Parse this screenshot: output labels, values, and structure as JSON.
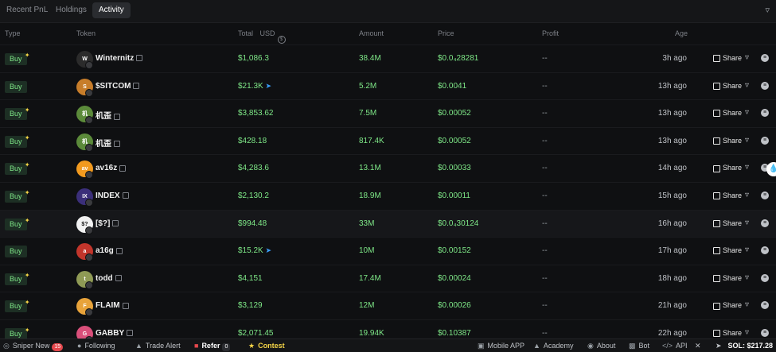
{
  "tabs": {
    "recent_pnl": "Recent PnL",
    "holdings": "Holdings",
    "activity": "Activity"
  },
  "columns": {
    "type": "Type",
    "token": "Token",
    "total": "Total",
    "total_unit": "USD",
    "amount": "Amount",
    "price": "Price",
    "profit": "Profit",
    "age": "Age"
  },
  "rows": [
    {
      "type": "Buy",
      "token": "Winternitz",
      "total": "$1,086.3",
      "amount": "38.4M",
      "price": "$0.0₄28281",
      "profit": "--",
      "age": "3h ago",
      "share": "Share",
      "avatar_color": "#2b2b2b",
      "avatar_text": "W"
    },
    {
      "type": "Buy",
      "token": "$SITCOM",
      "total": "$21.3K",
      "amount": "5.2M",
      "price": "$0.0041",
      "profit": "--",
      "age": "13h ago",
      "share": "Share",
      "avatar_color": "#c77d2a",
      "avatar_text": "S"
    },
    {
      "type": "Buy",
      "token": "机歪",
      "total": "$3,853.62",
      "amount": "7.5M",
      "price": "$0.00052",
      "profit": "--",
      "age": "13h ago",
      "share": "Share",
      "avatar_color": "#5b8a3a",
      "avatar_text": "机"
    },
    {
      "type": "Buy",
      "token": "机歪",
      "total": "$428.18",
      "amount": "817.4K",
      "price": "$0.00052",
      "profit": "--",
      "age": "13h ago",
      "share": "Share",
      "avatar_color": "#5b8a3a",
      "avatar_text": "机"
    },
    {
      "type": "Buy",
      "token": "av16z",
      "total": "$4,283.6",
      "amount": "13.1M",
      "price": "$0.00033",
      "profit": "--",
      "age": "14h ago",
      "share": "Share",
      "avatar_color": "#f29a1f",
      "avatar_text": "av"
    },
    {
      "type": "Buy",
      "token": "INDEX",
      "total": "$2,130.2",
      "amount": "18.9M",
      "price": "$0.00011",
      "profit": "--",
      "age": "15h ago",
      "share": "Share",
      "avatar_color": "#3b2f7a",
      "avatar_text": "IX"
    },
    {
      "type": "Buy",
      "token": "[$?]",
      "total": "$994.48",
      "amount": "33M",
      "price": "$0.0₄30124",
      "profit": "--",
      "age": "16h ago",
      "share": "Share",
      "avatar_color": "#f2f2f2",
      "avatar_text": "$?"
    },
    {
      "type": "Buy",
      "token": "a16g",
      "total": "$15.2K",
      "amount": "10M",
      "price": "$0.00152",
      "profit": "--",
      "age": "17h ago",
      "share": "Share",
      "avatar_color": "#c2352b",
      "avatar_text": "a"
    },
    {
      "type": "Buy",
      "token": "todd",
      "total": "$4,151",
      "amount": "17.4M",
      "price": "$0.00024",
      "profit": "--",
      "age": "18h ago",
      "share": "Share",
      "avatar_color": "#8f9a55",
      "avatar_text": "t"
    },
    {
      "type": "Buy",
      "token": "FLAIM",
      "total": "$3,129",
      "amount": "12M",
      "price": "$0.00026",
      "profit": "--",
      "age": "21h ago",
      "share": "Share",
      "avatar_color": "#e8a33a",
      "avatar_text": "F"
    },
    {
      "type": "Buy",
      "token": "GABBY",
      "total": "$2,071.45",
      "amount": "19.94K",
      "price": "$0.10387",
      "profit": "--",
      "age": "22h ago",
      "share": "Share",
      "avatar_color": "#d94f7a",
      "avatar_text": "G"
    }
  ],
  "footer": {
    "sniper_new": "Sniper New",
    "sniper_count": "15",
    "following": "Following",
    "trade_alert": "Trade Alert",
    "refer": "Refer",
    "refer_count": "0",
    "contest": "Contest",
    "mobile_app": "Mobile APP",
    "academy": "Academy",
    "about": "About",
    "bot": "Bot",
    "api": "API",
    "sol": "SOL: $217.28"
  }
}
